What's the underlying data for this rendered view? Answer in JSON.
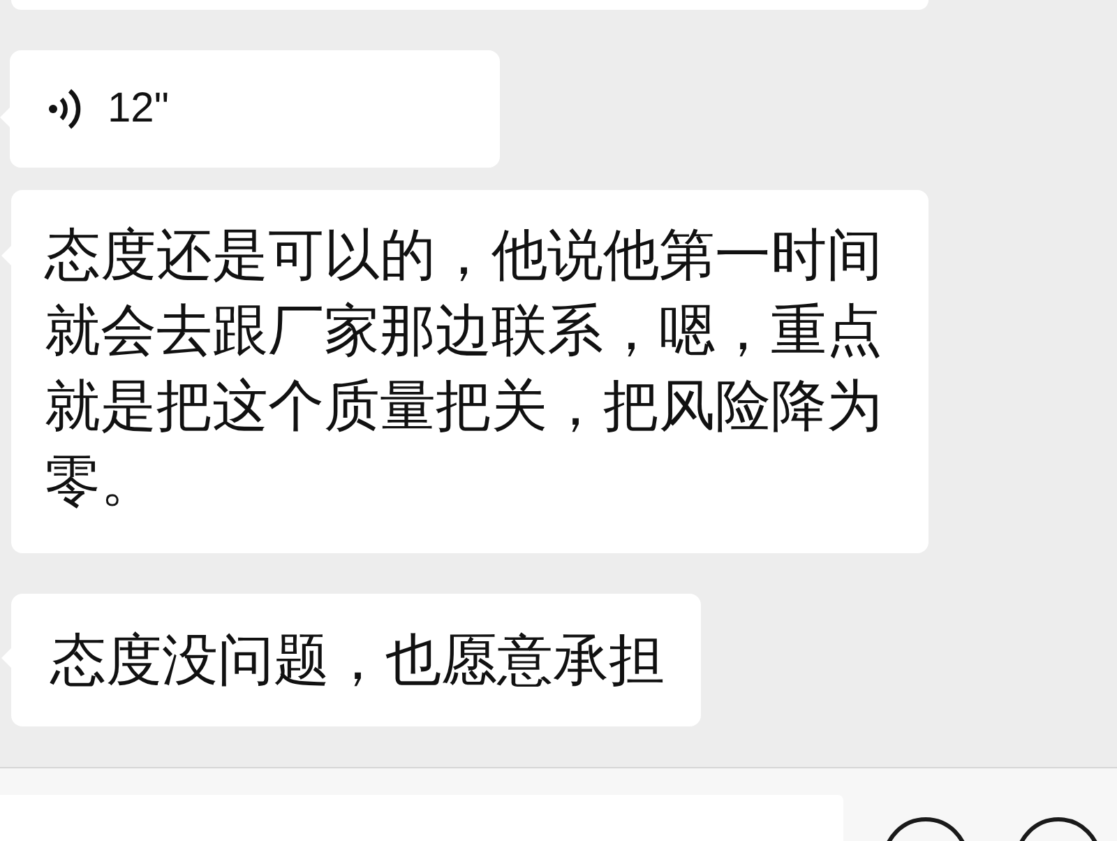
{
  "messages": [
    {
      "kind": "clipped"
    },
    {
      "kind": "voice",
      "duration": "12\""
    },
    {
      "kind": "text",
      "text": "态度还是可以的，他说他第一时间就会去跟厂家那边联系，嗯，重点就是把这个质量把关，把风险降为零。"
    },
    {
      "kind": "text",
      "text": "态度没问题，也愿意承担"
    }
  ],
  "composer": {
    "buttons": [
      {
        "kind": "circle"
      },
      {
        "kind": "circle"
      }
    ]
  }
}
